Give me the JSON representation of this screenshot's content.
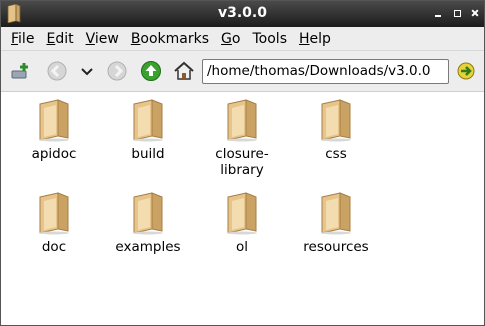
{
  "window": {
    "title": "v3.0.0"
  },
  "menubar": {
    "items": [
      {
        "label_u": "F",
        "label_rest": "ile"
      },
      {
        "label_u": "E",
        "label_rest": "dit"
      },
      {
        "label_u": "V",
        "label_rest": "iew"
      },
      {
        "label_u": "B",
        "label_rest": "ookmarks"
      },
      {
        "label_u": "G",
        "label_rest": "o"
      },
      {
        "label_u": "T",
        "label_rest": "ools",
        "label_pre": ""
      },
      {
        "label_u": "H",
        "label_rest": "elp"
      }
    ]
  },
  "toolbar": {
    "address": "/home/thomas/Downloads/v3.0.0",
    "icons": [
      "new-tab-icon",
      "back-icon",
      "history-dropdown-icon",
      "forward-icon",
      "up-icon",
      "home-icon",
      "go-icon"
    ]
  },
  "files": [
    {
      "name": "apidoc"
    },
    {
      "name": "build"
    },
    {
      "name": "closure-\nlibrary",
      "line1": "closure-",
      "line2": "library"
    },
    {
      "name": "css"
    },
    {
      "name": "doc"
    },
    {
      "name": "examples"
    },
    {
      "name": "ol"
    },
    {
      "name": "resources"
    }
  ],
  "colors": {
    "titlebar": "#2e2e2e",
    "toolbar": "#ededed",
    "folder": "#e8c98f",
    "go_green": "#3aa12f"
  }
}
